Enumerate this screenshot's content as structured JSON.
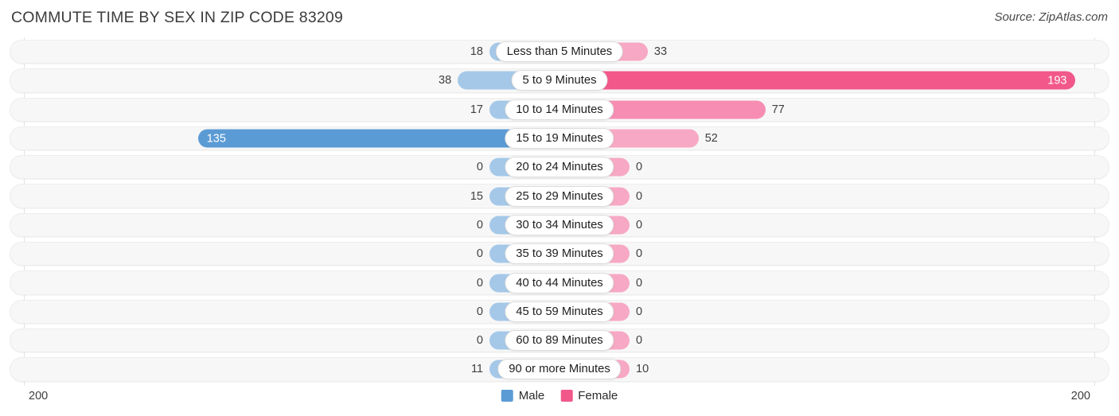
{
  "header": {
    "title": "COMMUTE TIME BY SEX IN ZIP CODE 83209",
    "source": "Source: ZipAtlas.com"
  },
  "footer": {
    "axis_left": "200",
    "axis_right": "200",
    "legend": [
      {
        "label": "Male",
        "color": "#5b9bd5",
        "icon": "male-color-swatch"
      },
      {
        "label": "Female",
        "color": "#f2588a",
        "icon": "female-color-swatch"
      }
    ]
  },
  "colors": {
    "male_light": "#a5c8e8",
    "male_strong": "#5b9bd5",
    "female_light": "#f7a8c4",
    "female_mid": "#f78db3",
    "female_strong": "#f2588a",
    "track": "#f7f7f7",
    "axis": "#e2e2e2"
  },
  "chart_data": {
    "type": "bar",
    "subtype": "diverging-bar",
    "title": "Commute Time by Sex in Zip Code 83209",
    "xlabel": "",
    "ylabel": "",
    "xlim": [
      200,
      200
    ],
    "axis_max": 200,
    "grid": false,
    "legend_position": "bottom-center",
    "categories": [
      "Less than 5 Minutes",
      "5 to 9 Minutes",
      "10 to 14 Minutes",
      "15 to 19 Minutes",
      "20 to 24 Minutes",
      "25 to 29 Minutes",
      "30 to 34 Minutes",
      "35 to 39 Minutes",
      "40 to 44 Minutes",
      "45 to 59 Minutes",
      "60 to 89 Minutes",
      "90 or more Minutes"
    ],
    "series": [
      {
        "name": "Male",
        "values": [
          18,
          38,
          17,
          135,
          0,
          15,
          0,
          0,
          0,
          0,
          0,
          11
        ]
      },
      {
        "name": "Female",
        "values": [
          33,
          193,
          77,
          52,
          0,
          0,
          0,
          0,
          0,
          0,
          0,
          10
        ]
      }
    ]
  },
  "rows": [
    {
      "label": "Less than 5 Minutes",
      "male": "18",
      "female": "33",
      "male_inside": false,
      "female_inside": false
    },
    {
      "label": "5 to 9 Minutes",
      "male": "38",
      "female": "193",
      "male_inside": false,
      "female_inside": true
    },
    {
      "label": "10 to 14 Minutes",
      "male": "17",
      "female": "77",
      "male_inside": false,
      "female_inside": false
    },
    {
      "label": "15 to 19 Minutes",
      "male": "135",
      "female": "52",
      "male_inside": true,
      "female_inside": false
    },
    {
      "label": "20 to 24 Minutes",
      "male": "0",
      "female": "0",
      "male_inside": false,
      "female_inside": false
    },
    {
      "label": "25 to 29 Minutes",
      "male": "15",
      "female": "0",
      "male_inside": false,
      "female_inside": false
    },
    {
      "label": "30 to 34 Minutes",
      "male": "0",
      "female": "0",
      "male_inside": false,
      "female_inside": false
    },
    {
      "label": "35 to 39 Minutes",
      "male": "0",
      "female": "0",
      "male_inside": false,
      "female_inside": false
    },
    {
      "label": "40 to 44 Minutes",
      "male": "0",
      "female": "0",
      "male_inside": false,
      "female_inside": false
    },
    {
      "label": "45 to 59 Minutes",
      "male": "0",
      "female": "0",
      "male_inside": false,
      "female_inside": false
    },
    {
      "label": "60 to 89 Minutes",
      "male": "0",
      "female": "0",
      "male_inside": false,
      "female_inside": false
    },
    {
      "label": "90 or more Minutes",
      "male": "11",
      "female": "10",
      "male_inside": false,
      "female_inside": false
    }
  ]
}
